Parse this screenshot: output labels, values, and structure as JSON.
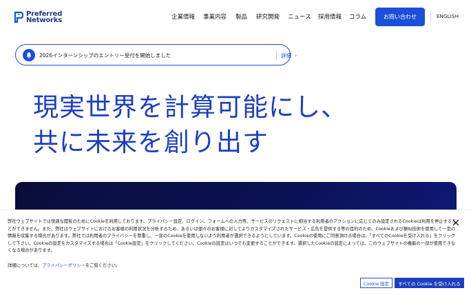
{
  "header": {
    "logo": {
      "line1": "Preferred",
      "line2": "Networks"
    },
    "nav": [
      {
        "label": "企業情報"
      },
      {
        "label": "事業内容"
      },
      {
        "label": "製品"
      },
      {
        "label": "研究開発"
      },
      {
        "label": "ニュース"
      },
      {
        "label": "採用情報"
      },
      {
        "label": "コラム"
      }
    ],
    "contact_label": "お問い合わせ",
    "lang_label": "ENGLISH"
  },
  "notice": {
    "icon": "bell-icon",
    "text": "2026インターンシップのエントリー受付を開始しました",
    "link_label": "詳細"
  },
  "hero": {
    "line1": "現実世界を計算可能にし、",
    "line2": "共に未来を創り出す"
  },
  "cookie": {
    "body": "弊社ウェブサイトでは快適な閲覧のためにCookieを利用しております。プライバシー設定、ログイン、フォームへの入力等、サービスのリクエストに相当する利用者のアクションに応じてのみ設定されるCookieは利用を停止することができません。また、弊社はウェブサイトにおけるお客様の利用状況を分析するため、あるいは個々のお客様に対してよりカスタマイズされたサービス・広告を提供する等の目的のため、Cookieおよび類似技術を使用して一定の情報を収集する場合があります。弊社では利用者のプライバシーを尊重し、一部のCookieを使用しないよう利用者が選択できるようにしています。Cookieの使用にご同意頂ける場合は、「すべてのCookieを受け入れる」をクリックして下さい。Cookieの設定をカスタマイズする場合は「Cookie設定」をクリックしてください。Cookieの設定はいつでも変更することができます。選択したCookieの設定によっては、このウェブサイトの機能の一部が使用できなくなる場合があります。",
    "detail_prefix": "詳細については、",
    "detail_link": "プライバシーポリシー",
    "detail_suffix": "をご覧ください。",
    "settings_label": "Cookie 設定",
    "accept_label": "すべての Cookie を受け入れる"
  },
  "colors": {
    "brand": "#1c4fd8",
    "hero_text": "#1c3fbf",
    "dark_panel": "#0b1255"
  }
}
